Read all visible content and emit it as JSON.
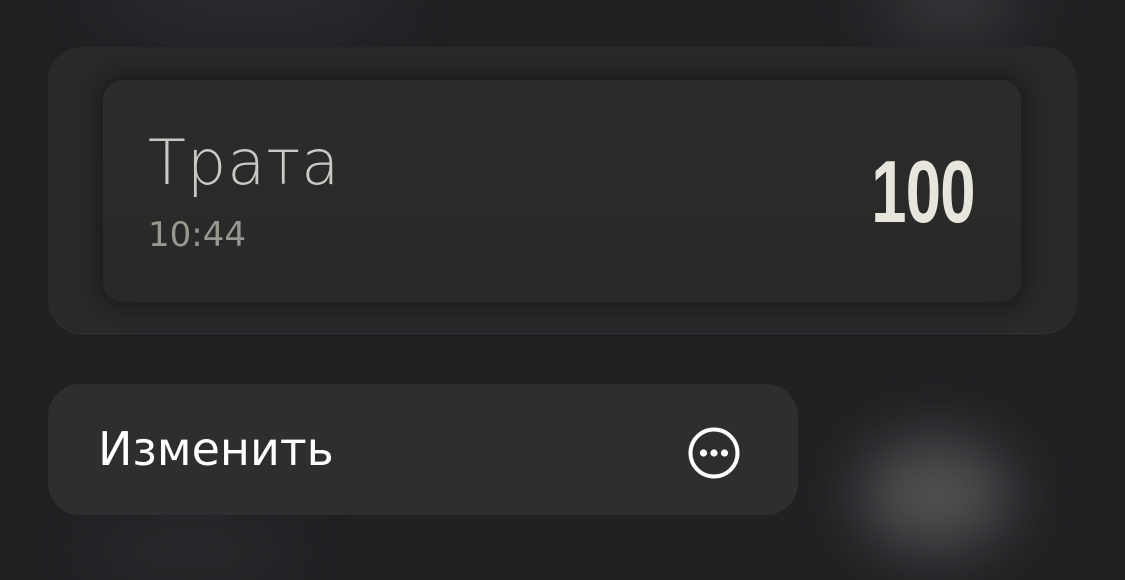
{
  "preview": {
    "title": "Трата",
    "time": "10:44",
    "amount": "100"
  },
  "menu": {
    "items": [
      {
        "label": "Изменить",
        "icon": "ellipsis-circle-icon"
      }
    ]
  },
  "colors": {
    "background": "#212124",
    "card": "#29292b",
    "tile": "#2a2a2a",
    "menu": "#2e2e30",
    "title_text": "#c9c9c3",
    "time_text": "#97978f",
    "amount_text": "#e7e5dc",
    "menu_text": "#ffffff"
  }
}
